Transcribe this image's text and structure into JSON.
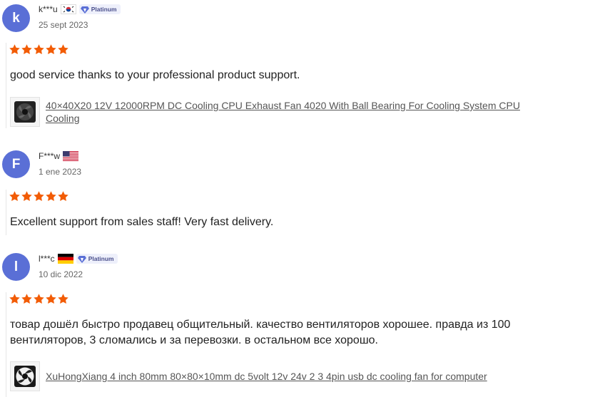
{
  "reviews": [
    {
      "avatar_letter": "k",
      "username": "k***u",
      "country_flag": "south-korea-flag",
      "badge": "Platinum",
      "date": "25 sept 2023",
      "rating": 5,
      "text": "good service thanks to your professional product support.",
      "product_link": "40×40X20 12V 12000RPM DC Cooling CPU Exhaust Fan 4020 With Ball Bearing For Cooling System CPU Cooling"
    },
    {
      "avatar_letter": "F",
      "username": "F***w",
      "country_flag": "usa-flag",
      "badge": "",
      "date": "1 ene 2023",
      "rating": 5,
      "text": "Excellent support from sales staff! Very fast delivery.",
      "product_link": ""
    },
    {
      "avatar_letter": "l",
      "username": "l***c",
      "country_flag": "germany-flag",
      "badge": "Platinum",
      "date": "10 dic 2022",
      "rating": 5,
      "text": "товар дошёл быстро продавец общительный. качество вентиляторов хорошее. правда из 100 вентиляторов, 3 сломались и за перевозки. в остальном все хорошо.",
      "product_link": "XuHongXiang 4 inch 80mm 80×80×10mm dc 5volt 12v 24v 2 3 4pin usb dc cooling fan for computer"
    }
  ],
  "colors": {
    "avatar": "#5a6fd6",
    "star": "#f25c05",
    "badge_bg": "#eef0fb"
  }
}
